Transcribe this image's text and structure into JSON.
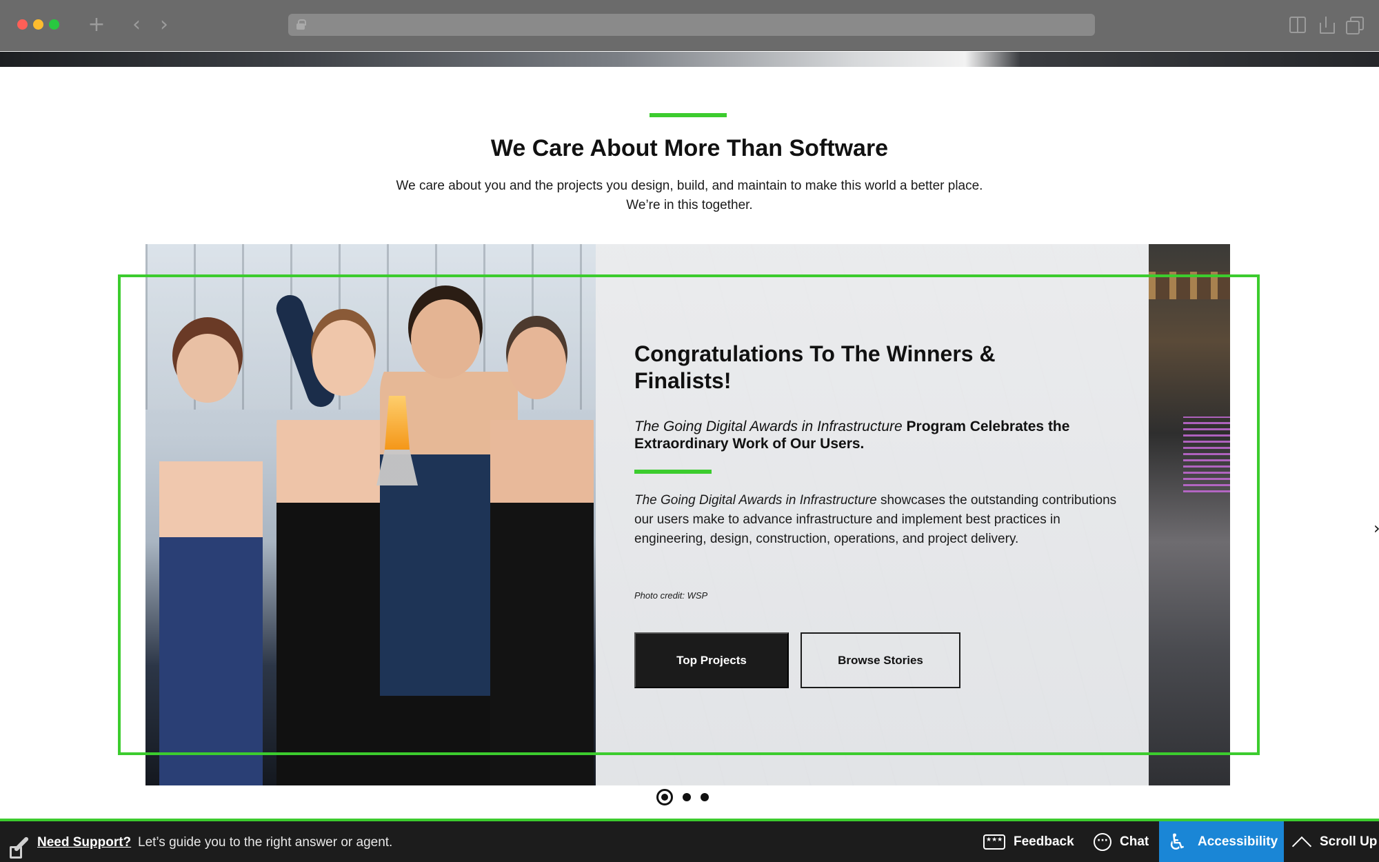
{
  "browser": {
    "new_tab_glyph": "+",
    "back_glyph": "‹",
    "forward_glyph": "›",
    "url": ""
  },
  "section": {
    "title": "We Care About More Than Software",
    "subtitle_line1": "We care about you and the projects you design, build, and maintain to make this world a better place.",
    "subtitle_line2": "We’re in this together."
  },
  "carousel": {
    "active_index": 0,
    "slide_count": 3,
    "slide": {
      "title": "Congratulations To The Winners & Finalists!",
      "lead_em": "The Going Digital Awards in Infrastructure",
      "lead_rest": " Program Celebrates the Extraordinary Work of Our Users.",
      "body_em": "The Going Digital Awards in Infrastructure",
      "body_rest": " showcases the outstanding contributions our users make to advance infrastructure and implement best practices in engineering, design, construction, operations, and project delivery.",
      "photo_credit": "Photo credit: WSP",
      "primary_button": "Top Projects",
      "secondary_button": "Browse Stories"
    },
    "next_arrow_glyph": "›"
  },
  "support_bar": {
    "link": "Need Support?",
    "text": "Let’s guide you to the right answer or agent.",
    "feedback": "Feedback",
    "chat": "Chat",
    "accessibility": "Accessibility",
    "scroll_up": "Scroll Up",
    "accessibility_glyph": "♿"
  },
  "colors": {
    "accent_green": "#3ccc2e",
    "accessibility_blue": "#1a86d6",
    "dark": "#1b1b1b"
  }
}
